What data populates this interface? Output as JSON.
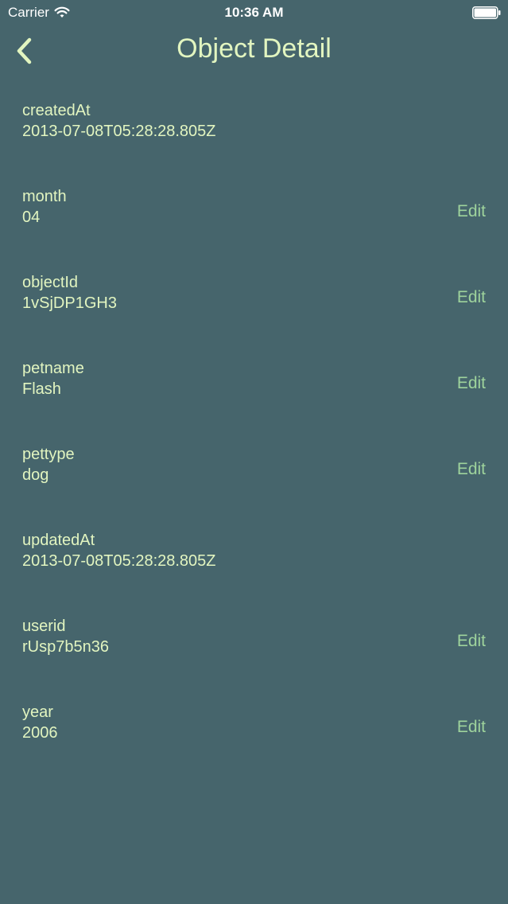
{
  "status_bar": {
    "carrier": "Carrier",
    "time": "10:36 AM"
  },
  "nav": {
    "title": "Object Detail",
    "back_icon": "chevron-left-icon"
  },
  "colors": {
    "background": "#46656c",
    "text": "#e2f5c0",
    "edit": "#9ed39c"
  },
  "fields": [
    {
      "key": "createdAt",
      "value": "2013-07-08T05:28:28.805Z",
      "editable": false,
      "edit_label": ""
    },
    {
      "key": "month",
      "value": "04",
      "editable": true,
      "edit_label": "Edit"
    },
    {
      "key": "objectId",
      "value": "1vSjDP1GH3",
      "editable": true,
      "edit_label": "Edit"
    },
    {
      "key": "petname",
      "value": "Flash",
      "editable": true,
      "edit_label": "Edit"
    },
    {
      "key": "pettype",
      "value": "dog",
      "editable": true,
      "edit_label": "Edit"
    },
    {
      "key": "updatedAt",
      "value": "2013-07-08T05:28:28.805Z",
      "editable": false,
      "edit_label": ""
    },
    {
      "key": "userid",
      "value": "rUsp7b5n36",
      "editable": true,
      "edit_label": "Edit"
    },
    {
      "key": "year",
      "value": "2006",
      "editable": true,
      "edit_label": "Edit"
    }
  ]
}
